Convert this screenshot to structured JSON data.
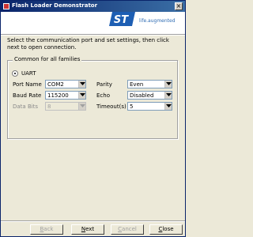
{
  "window": {
    "title": "Flash Loader Demonstrator",
    "close_glyph": "×"
  },
  "banner": {
    "logo_text": "ST",
    "tagline": "life.augmented"
  },
  "instructions": "Select the communication port and set settings, then click next to open connection.",
  "group": {
    "title": "Common for all families",
    "protocol": {
      "label": "UART",
      "selected": true
    }
  },
  "fields": {
    "port_name": {
      "label": "Port Name",
      "value": "COM2"
    },
    "baud_rate": {
      "label": "Baud Rate",
      "value": "115200"
    },
    "data_bits": {
      "label": "Data Bits",
      "value": "8",
      "disabled": true
    },
    "parity": {
      "label": "Parity",
      "value": "Even"
    },
    "echo": {
      "label": "Echo",
      "value": "Disabled"
    },
    "timeout": {
      "label": "Timeout(s)",
      "value": "5"
    }
  },
  "buttons": {
    "back": {
      "mnemonic": "B",
      "rest": "ack",
      "disabled": true
    },
    "next": {
      "mnemonic": "N",
      "rest": "ext",
      "disabled": false
    },
    "cancel": {
      "mnemonic": "C",
      "rest": "ancel",
      "disabled": true
    },
    "close": {
      "mnemonic": "C",
      "rest": "lose",
      "disabled": false
    }
  },
  "colors": {
    "titlebar": "#0a246a",
    "accent_blue": "#2d6bb3",
    "window_bg": "#ece9d8"
  }
}
